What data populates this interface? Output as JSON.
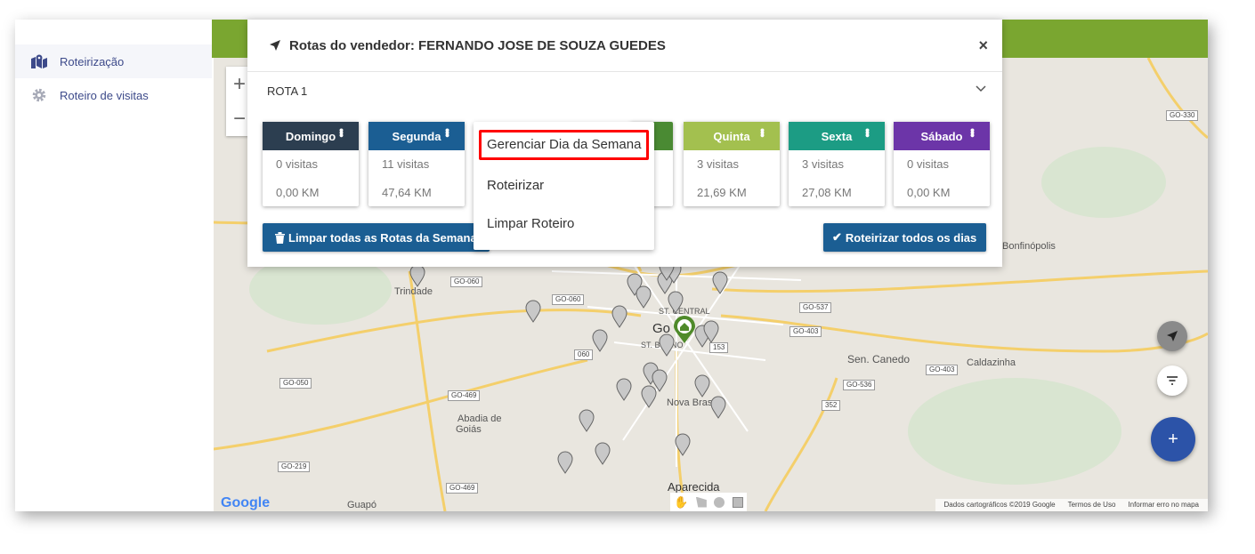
{
  "sidebar": {
    "items": [
      {
        "label": "Roteirização",
        "icon": "map-marker-icon",
        "active": true
      },
      {
        "label": "Roteiro de visitas",
        "icon": "gear-icon"
      }
    ]
  },
  "modal": {
    "title": "Rotas do vendedor: FERNANDO JOSE DE SOUZA GUEDES",
    "close": "×",
    "route_label": "ROTA 1",
    "days": [
      {
        "name": "Domingo",
        "visits": "0 visitas",
        "km": "0,00 KM",
        "color": "#2c3e50"
      },
      {
        "name": "Segunda",
        "visits": "11 visitas",
        "km": "47,64 KM",
        "color": "#1b5e93"
      },
      {
        "name": "Quinta",
        "visits": "3 visitas",
        "km": "21,69 KM",
        "color": "#a3c04f"
      },
      {
        "name": "Sexta",
        "visits": "3 visitas",
        "km": "27,08 KM",
        "color": "#1c9c84"
      },
      {
        "name": "Sábado",
        "visits": "0 visitas",
        "km": "0,00 KM",
        "color": "#6c35a8"
      }
    ],
    "hidden_day_color": "#4a8a33",
    "clear_button": "Limpar todas as Rotas da Semana",
    "route_all_button": "Roteirizar todos os dias"
  },
  "context_menu": {
    "items": [
      "Gerenciar Dia da Semana",
      "Roteirizar",
      "Limpar Roteiro"
    ]
  },
  "map": {
    "zoom_in": "+",
    "zoom_out": "−",
    "labels": {
      "trindade": "Trindade",
      "abadia": "Abadia de",
      "abadia2": "Goiás",
      "guapo": "Guapó",
      "aparecida": "Aparecida",
      "nova": "Nova Bras",
      "canedo": "Sen. Canedo",
      "caldazinha": "Caldazinha",
      "bonfinopolis": "Bonfinópolis",
      "central": "ST. CENTRAL",
      "bueno": "ST. BUENO",
      "goiania": "Go"
    },
    "shields": {
      "go060a": "GO-060",
      "go060b": "GO-060",
      "go050": "GO-050",
      "go469a": "GO-469",
      "go469b": "GO-469",
      "go219": "GO-219",
      "go537": "GO-537",
      "go403a": "GO-403",
      "go403b": "GO-403",
      "go536": "GO-536",
      "s352": "352",
      "go330": "GO-330",
      "s060": "060",
      "s153": "153"
    },
    "google": "Google",
    "attribution": "Dados cartográficos ©2019 Google",
    "terms": "Termos de Uso",
    "report": "Informar erro no mapa",
    "fab_add": "+"
  }
}
